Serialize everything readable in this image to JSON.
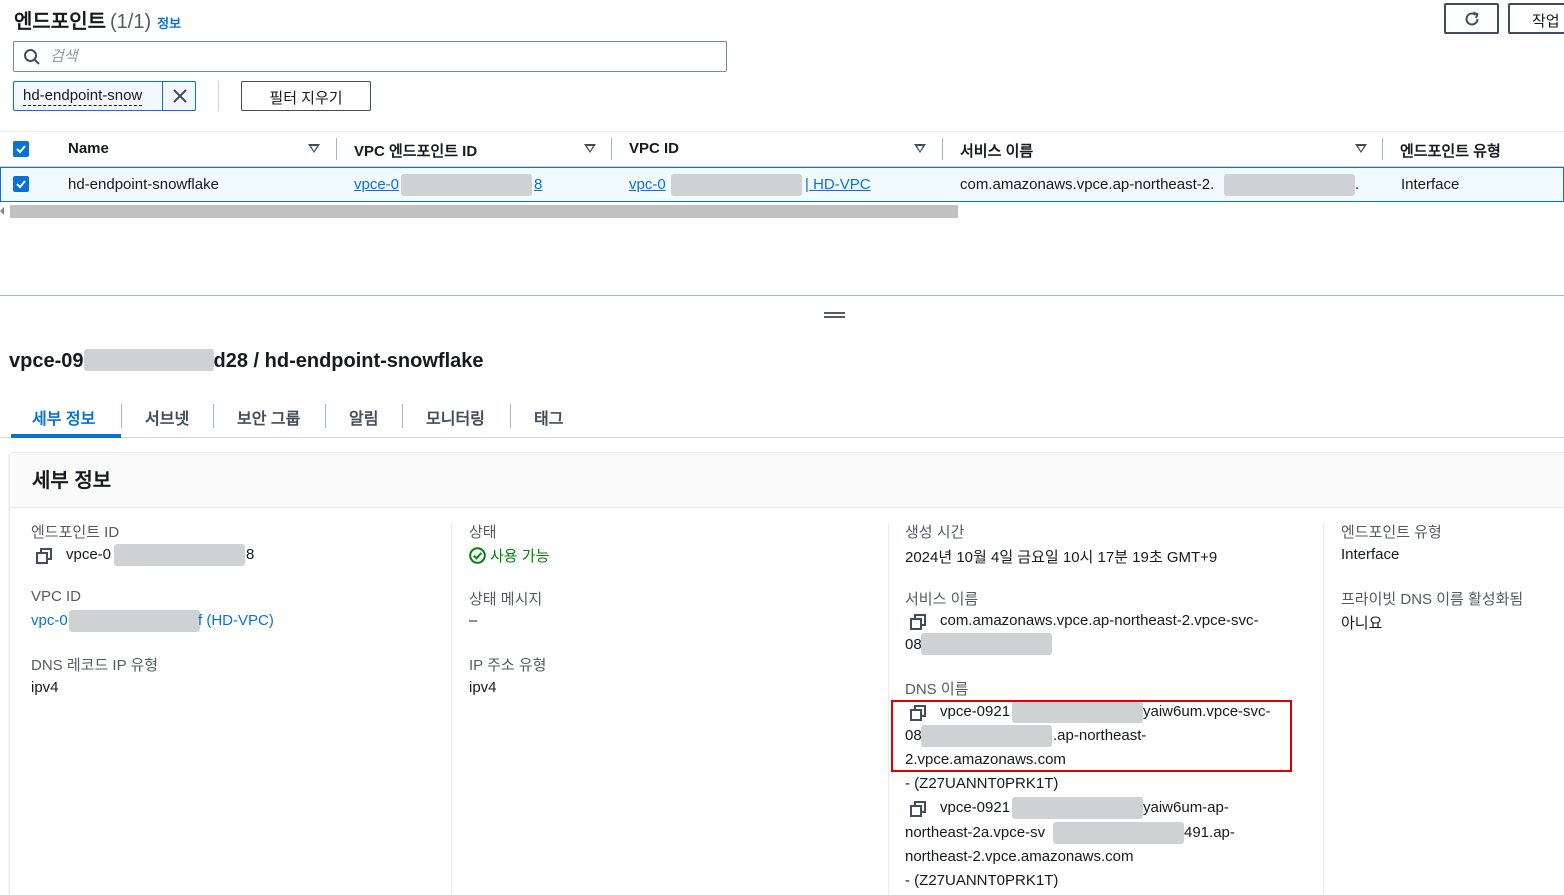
{
  "list": {
    "title": "엔드포인트",
    "count": "(1/1)",
    "info_link": "정보",
    "refresh_label": "",
    "action_label": "작업",
    "search_placeholder": "검색",
    "filter_token": "hd-endpoint-snow",
    "clear_filter_label": "필터 지우기",
    "columns": [
      "Name",
      "VPC 엔드포인트 ID",
      "VPC ID",
      "서비스 이름",
      "엔드포인트 유형"
    ],
    "rows": [
      {
        "name": "hd-endpoint-snowflake",
        "endpoint_id_prefix": "vpce-0",
        "endpoint_id_suffix": "8",
        "vpc_id_prefix": "vpc-0",
        "vpc_id_suffix": "| HD-VPC",
        "service_prefix": "com.amazonaws.vpce.ap-northeast-2.",
        "service_suffix": ".",
        "endpoint_type": "Interface"
      }
    ]
  },
  "detail": {
    "title_prefix": "vpce-09",
    "title_suffix": "d28 / hd-endpoint-snowflake",
    "tabs": [
      "세부 정보",
      "서브넷",
      "보안 그룹",
      "알림",
      "모니터링",
      "태그"
    ],
    "card_title": "세부 정보",
    "col1": {
      "endpoint_id_label": "엔드포인트 ID",
      "endpoint_id_prefix": "vpce-0",
      "endpoint_id_suffix": "8",
      "vpc_id_label": "VPC ID",
      "vpc_id_prefix": "vpc-0",
      "vpc_id_suffix": "f (HD-VPC)",
      "dns_record_label": "DNS 레코드 IP 유형",
      "dns_record_value": "ipv4"
    },
    "col2": {
      "status_label": "상태",
      "status_value": "사용 가능",
      "status_msg_label": "상태 메시지",
      "status_msg_value": "–",
      "ip_type_label": "IP 주소 유형",
      "ip_type_value": "ipv4"
    },
    "col3": {
      "created_label": "생성 시간",
      "created_value": "2024년 10월 4일 금요일 10시 17분 19초 GMT+9",
      "service_label": "서비스 이름",
      "service_line1": "com.amazonaws.vpce.ap-northeast-2.vpce-svc-",
      "service_line2_prefix": "08",
      "dns_label": "DNS 이름",
      "dns1_line1_prefix": "vpce-0921",
      "dns1_line1_suffix": "yaiw6um.vpce-svc-",
      "dns1_line2_prefix": "08",
      "dns1_line2_suffix": ".ap-northeast-",
      "dns1_line3": "2.vpce.amazonaws.com",
      "dns1_zone": "- (Z27UANNT0PRK1T)",
      "dns2_line1_prefix": "vpce-0921",
      "dns2_line1_suffix": "yaiw6um-ap-",
      "dns2_line2_prefix": "northeast-2a.vpce-sv",
      "dns2_line2_suffix": "491.ap-",
      "dns2_line3": "northeast-2.vpce.amazonaws.com",
      "dns2_zone": "- (Z27UANNT0PRK1T)"
    },
    "col4": {
      "type_label": "엔드포인트 유형",
      "type_value": "Interface",
      "private_dns_label": "프라이빗 DNS 이름 활성화됨",
      "private_dns_value": "아니요"
    }
  },
  "colors": {
    "link": "#0972d3",
    "success": "#037f0c",
    "highlight": "#e00000"
  }
}
